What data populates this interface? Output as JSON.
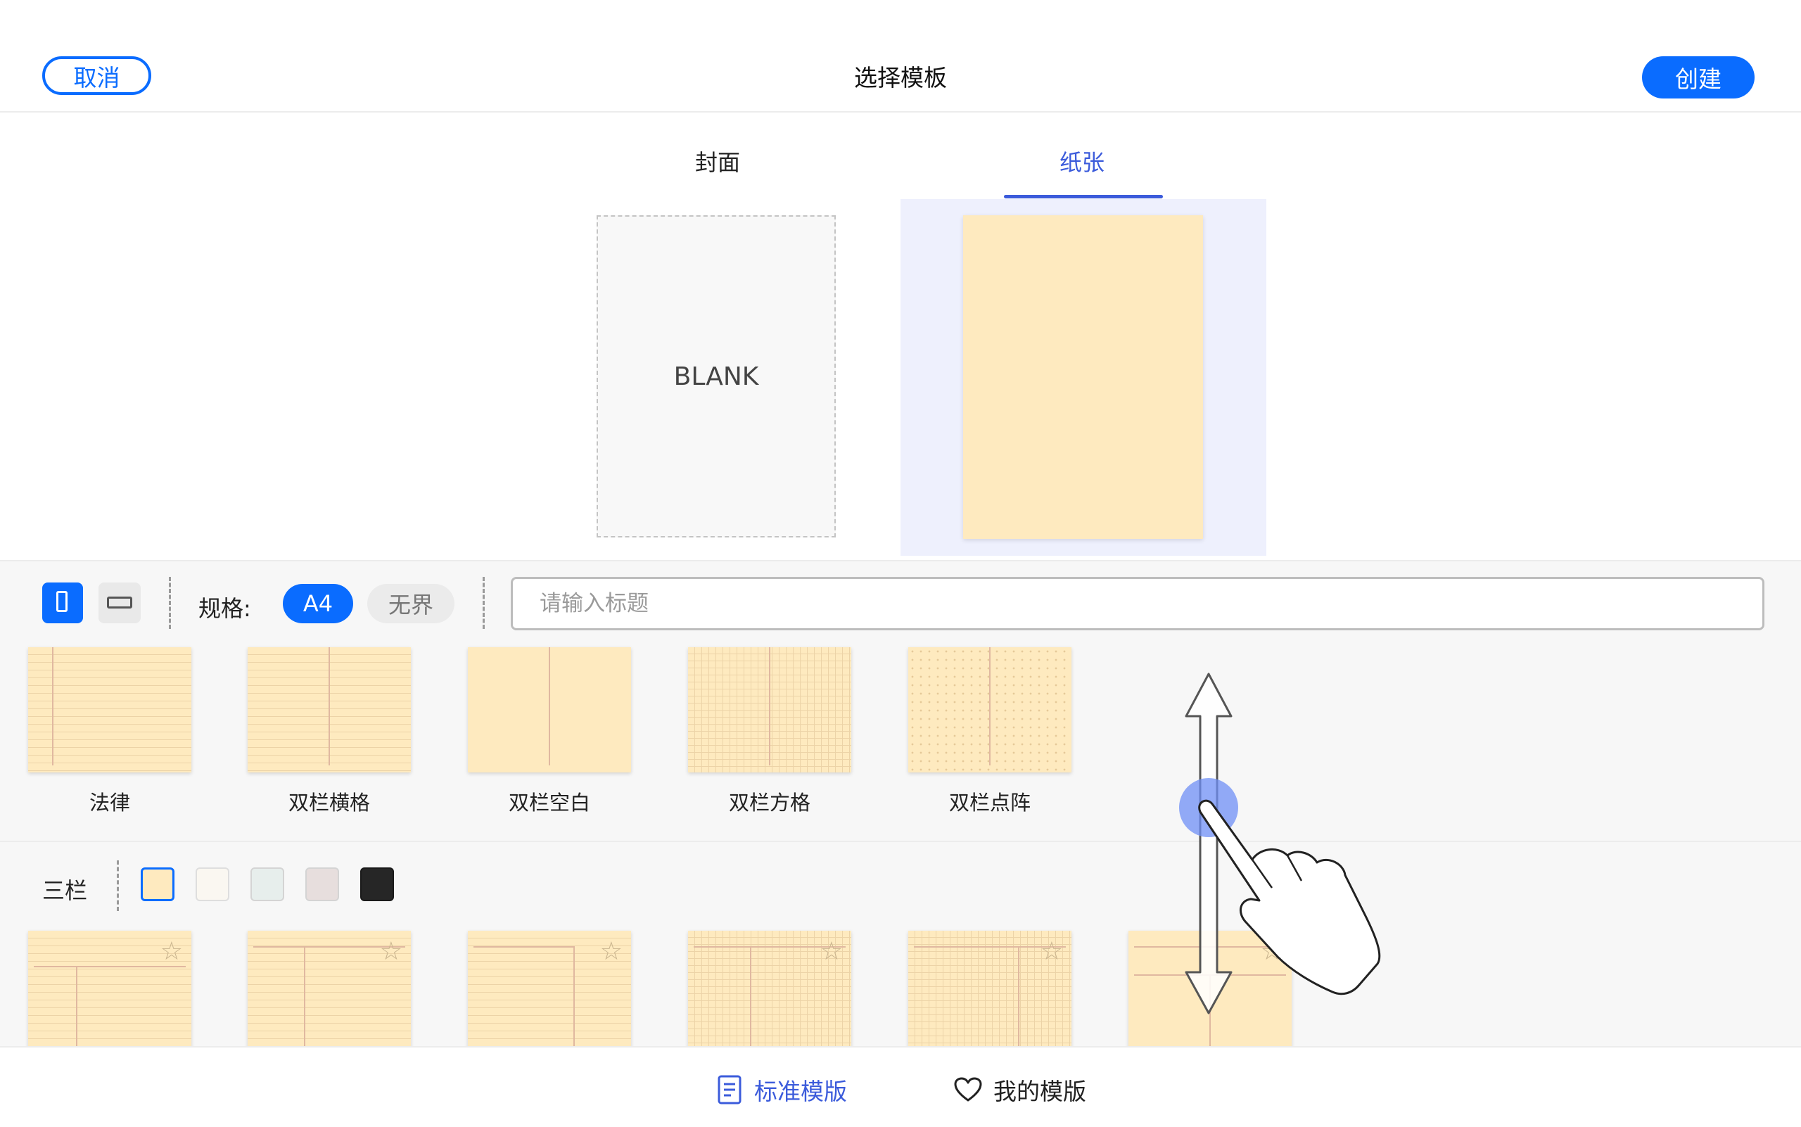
{
  "header": {
    "cancel_label": "取消",
    "title": "选择模板",
    "create_label": "创建"
  },
  "tabs": [
    {
      "label": "封面",
      "selected": false
    },
    {
      "label": "纸张",
      "selected": true
    }
  ],
  "preview": {
    "blank_label": "BLANK",
    "selected_paper_color": "#feeabf"
  },
  "toolbar": {
    "orientation": "portrait",
    "spec_label": "规格:",
    "spec_options": [
      "A4",
      "无界"
    ],
    "spec_selected": "A4",
    "title_placeholder": "请输入标题",
    "title_value": ""
  },
  "two_column_templates": [
    {
      "label": "法律",
      "pattern": "ruled"
    },
    {
      "label": "双栏横格",
      "pattern": "ruled"
    },
    {
      "label": "双栏空白",
      "pattern": "blank"
    },
    {
      "label": "双栏方格",
      "pattern": "grid"
    },
    {
      "label": "双栏点阵",
      "pattern": "dots"
    }
  ],
  "three_column": {
    "label": "三栏",
    "colors": [
      "#feeabf",
      "#faf7f1",
      "#e7eeec",
      "#e7dedd",
      "#262626"
    ],
    "selected_color": "#feeabf",
    "template_count": 6
  },
  "bottom_nav": {
    "standard_label": "标准模版",
    "mine_label": "我的模版",
    "selected": "standard"
  },
  "colors": {
    "accent": "#0a6cff",
    "tab_accent": "#3b5bdb",
    "paper": "#feeabf"
  }
}
